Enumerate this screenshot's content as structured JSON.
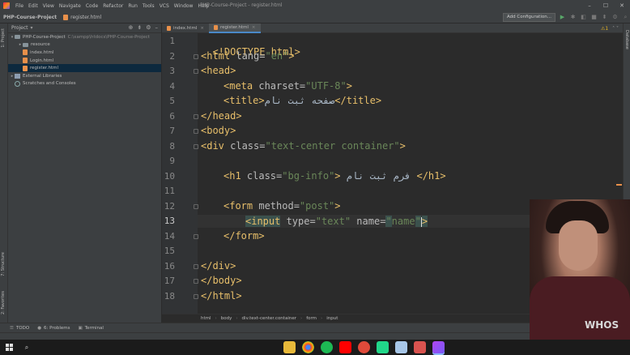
{
  "menubar": {
    "items": [
      "File",
      "Edit",
      "View",
      "Navigate",
      "Code",
      "Refactor",
      "Run",
      "Tools",
      "VCS",
      "Window",
      "Help"
    ],
    "window_title": "PHP-Course-Project - register.html"
  },
  "navbar": {
    "project": "PHP-Course-Project",
    "file": "register.html",
    "add_configuration": "Add Configuration..."
  },
  "left_strip": {
    "project_tab": "1: Project",
    "structure_tab": "7: Structure",
    "favorites_tab": "2: Favorites"
  },
  "right_strip": {
    "database_tab": "Database"
  },
  "project_panel": {
    "title": "Project",
    "tree": [
      {
        "label": "PHP-Course-Project",
        "path": "C:\\xampp\\htdocs\\PHP-Course-Project",
        "type": "folder",
        "depth": 0,
        "expanded": true
      },
      {
        "label": "resource",
        "type": "folder",
        "depth": 1,
        "expanded": false
      },
      {
        "label": "index.html",
        "type": "file",
        "depth": 1
      },
      {
        "label": "Login.html",
        "type": "file",
        "depth": 1
      },
      {
        "label": "register.html",
        "type": "file",
        "depth": 1,
        "selected": true
      },
      {
        "label": "External Libraries",
        "type": "lib",
        "depth": 0,
        "expanded": false
      },
      {
        "label": "Scratches and Consoles",
        "type": "scratch",
        "depth": 0
      }
    ]
  },
  "editor_tabs": [
    {
      "label": "index.html",
      "active": false
    },
    {
      "label": "register.html",
      "active": true
    }
  ],
  "inspection": {
    "warnings": "1"
  },
  "editor": {
    "line_numbers": [
      "1",
      "2",
      "3",
      "4",
      "5",
      "6",
      "7",
      "8",
      "9",
      "10",
      "11",
      "12",
      "13",
      "14",
      "15",
      "16",
      "17",
      "18"
    ],
    "current_line": "13",
    "lines": {
      "l1": {
        "a": "<!DOCTYPE html>"
      },
      "l2": {
        "a": "<html",
        "b": " lang=",
        "c": "\"en\"",
        "d": ">"
      },
      "l3": {
        "a": "<head>"
      },
      "l4": {
        "a": "<meta",
        "b": " charset=",
        "c": "\"UTF-8\"",
        "d": ">"
      },
      "l5": {
        "a": "<title>",
        "b": "صفحه ثبت نام",
        "c": "</title>"
      },
      "l6": {
        "a": "</head>"
      },
      "l7": {
        "a": "<body>"
      },
      "l8": {
        "a": "<div",
        "b": " class=",
        "c": "\"text-center container\"",
        "d": ">"
      },
      "l10": {
        "a": "<h1",
        "b": " class=",
        "c": "\"bg-info\"",
        "d": ">",
        "e": "فرم ثبت نام",
        "f": "</h1>"
      },
      "l12": {
        "a": "<form",
        "b": " method=",
        "c": "\"post\"",
        "d": ">"
      },
      "l13": {
        "a": "<input",
        "b": " type=",
        "c": "\"text\"",
        "d": " name=",
        "e": "\"",
        "f": "name",
        "g": "\"",
        "h": ">"
      },
      "l14": {
        "a": "</form>"
      },
      "l16": {
        "a": "</div>"
      },
      "l17": {
        "a": "</body>"
      },
      "l18": {
        "a": "</html>"
      }
    }
  },
  "breadcrumb": [
    "html",
    "body",
    "div.text-center.container",
    "form",
    "input"
  ],
  "tool_windows": {
    "todo": "TODO",
    "problems": "6: Problems",
    "terminal": "Terminal"
  },
  "webcam": {
    "shirt_text": "WHOS"
  },
  "colors": {
    "tag": "#e8bf6a",
    "attr_value": "#6a8759",
    "attr_name": "#bababa",
    "selection": "#0d293e",
    "accent": "#4a88c7"
  }
}
